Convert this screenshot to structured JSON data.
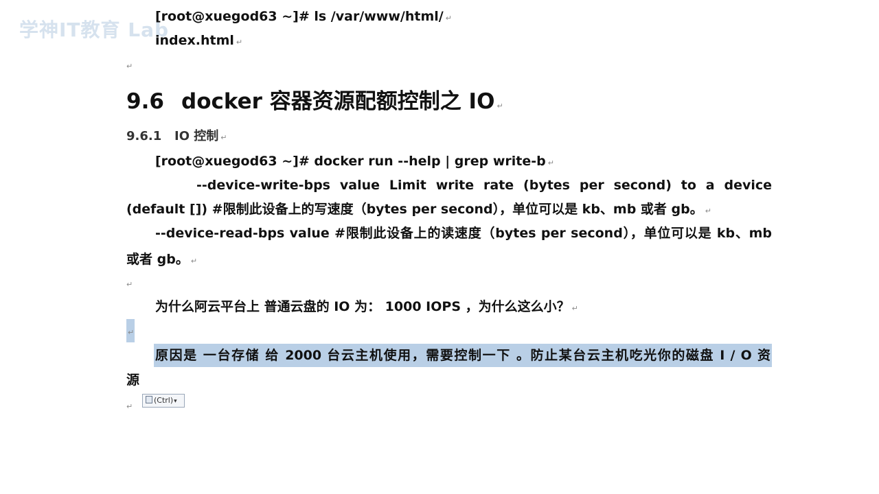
{
  "watermark": "学神IT教育 Lab",
  "lines": {
    "cmd_ls": "[root@xuegod63 ~]# ls /var/www/html/",
    "ls_output": "index.html"
  },
  "heading": {
    "number": "9.6",
    "title": "docker 容器资源配额控制之 IO"
  },
  "subheading": {
    "number": "9.6.1",
    "title": "IO 控制"
  },
  "help_cmd": "[root@xuegod63 ~]# docker run --help | grep write-b",
  "write_option": {
    "line1": "--device-write-bps value          Limit write rate (bytes per second) to a device",
    "line2": "(default [])   #限制此设备上的写速度（bytes per second），单位可以是 kb、mb 或者 gb。"
  },
  "read_option": {
    "line1": "--device-read-bps value    #限制此设备上的读速度（bytes per second），单位可以是 kb、mb",
    "line2": "或者 gb。"
  },
  "question": "为什么阿云平台上  普通云盘的 IO 为：  1000 IOPS   ，为什么这么小？",
  "answer": {
    "line1": "原因是  一台存储  给 2000 台云主机使用，需要控制一下 。防止某台云主机吃光你的磁盘 I / O 资",
    "line2": "源"
  },
  "paste_button": {
    "label": "(Ctrl)",
    "arrow": "▾"
  },
  "paragraph_mark": "↵"
}
